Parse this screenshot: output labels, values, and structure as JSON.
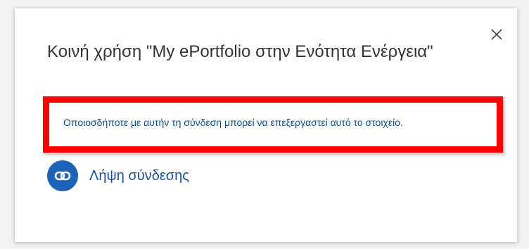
{
  "dialog": {
    "title": "Κοινή χρήση \"My ePortfolio στην Ενότητα Ενέργεια\"",
    "close_icon": "close-icon",
    "warning": "Οποιοσδήποτε με αυτήν τη σύνδεση μπορεί να επεξεργαστεί αυτό το στοιχείο.",
    "get_link": {
      "icon": "link-icon",
      "label": "Λήψη σύνδεσης"
    }
  },
  "colors": {
    "highlight_border": "#ff0000",
    "accent": "#1c62b9",
    "warning_text": "#0b4d97",
    "title_text": "#333333"
  }
}
